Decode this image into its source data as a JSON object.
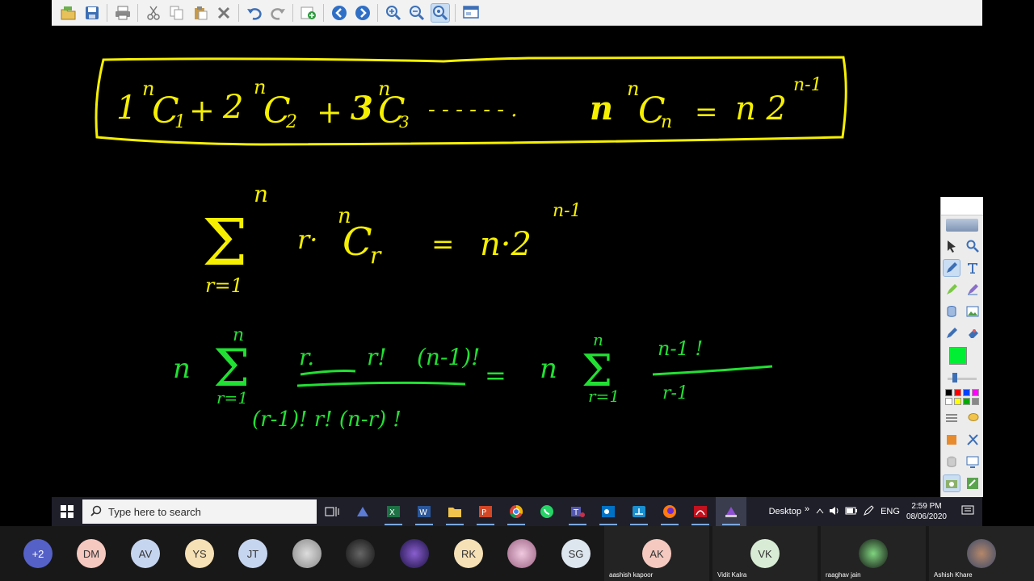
{
  "toolbar": {
    "buttons": [
      "open-icon",
      "save-icon",
      "print-icon",
      "cut-icon",
      "copy-icon",
      "paste-icon",
      "delete-icon",
      "undo-icon",
      "redo-icon",
      "new-page-icon",
      "previous-page-icon",
      "next-page-icon",
      "zoom-in-icon",
      "zoom-out-icon",
      "zoom-fit-icon",
      "display-icon"
    ]
  },
  "board": {
    "equation1": {
      "term1": "1",
      "term2": "2",
      "term3": "3",
      "sup": "n",
      "c": "C",
      "sub1": "1",
      "sub2": "2",
      "sub3": "3",
      "subn": "n",
      "plus": "+",
      "dots": "- - - - - - .",
      "lead_n": "n",
      "equals": "=",
      "rhs": "n 2",
      "rhs_exp": "n-1"
    },
    "equation2": {
      "sigma": "Σ",
      "upper": "n",
      "lower": "r=1",
      "body": "r·",
      "sup": "n",
      "c": "C",
      "sub": "r",
      "equals": "=",
      "rhs": "n·2",
      "rhs_exp": "n-1"
    },
    "equation3": {
      "lead_n": "n",
      "upper": "n",
      "lower": "r=1",
      "numerator_a": "r.",
      "numerator_b": "r!",
      "numerator_c": "(n-1)!",
      "denominator": "(r-1)!  r!  (n-r) !",
      "equals": "=",
      "rhs_n": "n",
      "rhs_upper": "n",
      "rhs_lower": "r=1",
      "rhs_numerator": "n-1 !",
      "rhs_denominator": "r-1"
    }
  },
  "palette": {
    "tools": [
      "select-icon",
      "zoom-icon",
      "pen-icon",
      "text-icon",
      "highlighter-icon",
      "magic-pen-icon",
      "fill-icon",
      "image-icon",
      "pointer-pen-icon",
      "eraser-icon"
    ],
    "current_color": "#00ee33",
    "swatches": [
      "#000000",
      "#ff0000",
      "#0044ff",
      "#ff00ff",
      "#ffffff",
      "#ffff00",
      "#00aa00",
      "#888888"
    ]
  },
  "taskbar": {
    "search_placeholder": "Type here to search",
    "apps": [
      "task-view",
      "vpn-app",
      "excel",
      "word",
      "file-explorer",
      "powerpoint",
      "chrome",
      "whatsapp",
      "teams",
      "outlook",
      "network-app",
      "firefox",
      "acrobat",
      "onenote"
    ],
    "desktop_label": "Desktop",
    "chevron": "»",
    "lang": "ENG",
    "time": "2:59 PM",
    "date": "08/06/2020"
  },
  "participants": {
    "more": "+2",
    "avatars": [
      "DM",
      "AV",
      "YS",
      "JT",
      "",
      "",
      "",
      "RK",
      "",
      "SG"
    ],
    "tiles": [
      {
        "initials": "AK",
        "name": "aashish kapoor"
      },
      {
        "initials": "VK",
        "name": "Vidit Kalra"
      },
      {
        "initials": "",
        "name": "raaghav jain"
      },
      {
        "initials": "",
        "name": "Ashish Khare"
      }
    ]
  }
}
